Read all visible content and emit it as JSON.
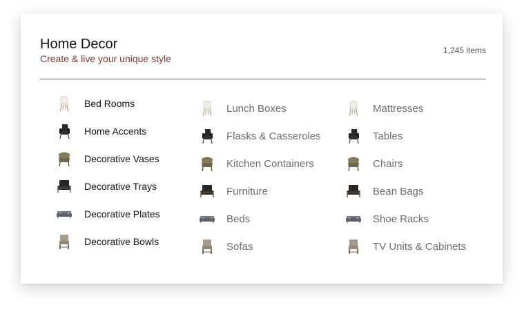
{
  "header": {
    "title": "Home Decor",
    "subtitle": "Create & live your unique style",
    "count": "1,245 items"
  },
  "columns": [
    [
      {
        "label": "Bed Rooms",
        "icon": "white-chair-icon"
      },
      {
        "label": "Home Accents",
        "icon": "black-armchair-icon"
      },
      {
        "label": "Decorative Vases",
        "icon": "olive-lounge-chair-icon"
      },
      {
        "label": "Decorative Trays",
        "icon": "black-lounge-chair-icon"
      },
      {
        "label": "Decorative Plates",
        "icon": "grey-sofa-icon"
      },
      {
        "label": "Decorative Bowls",
        "icon": "beige-chair-icon"
      }
    ],
    [
      {
        "label": "Lunch Boxes",
        "icon": "white-chair-icon"
      },
      {
        "label": "Flasks & Casseroles",
        "icon": "black-armchair-icon"
      },
      {
        "label": "Kitchen Containers",
        "icon": "olive-lounge-chair-icon"
      },
      {
        "label": "Furniture",
        "icon": "black-lounge-chair-icon"
      },
      {
        "label": "Beds",
        "icon": "grey-sofa-icon"
      },
      {
        "label": "Sofas",
        "icon": "beige-chair-icon"
      }
    ],
    [
      {
        "label": "Mattresses",
        "icon": "white-chair-icon"
      },
      {
        "label": "Tables",
        "icon": "black-armchair-icon"
      },
      {
        "label": "Chairs",
        "icon": "olive-lounge-chair-icon"
      },
      {
        "label": "Bean Bags",
        "icon": "black-lounge-chair-icon"
      },
      {
        "label": "Shoe Racks",
        "icon": "grey-sofa-icon"
      },
      {
        "label": "TV Units & Cabinets",
        "icon": "beige-chair-icon"
      }
    ]
  ],
  "colors": {
    "subtitle": "#7a3b32",
    "divider": "#7a5a52",
    "primary_text": "#111111",
    "secondary_text": "#6b6b6b"
  }
}
